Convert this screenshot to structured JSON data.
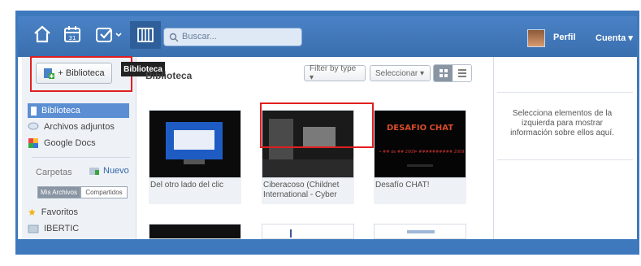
{
  "search": {
    "placeholder": "Buscar..."
  },
  "topbar": {
    "profile": "Perfil",
    "account": "Cuenta ▾"
  },
  "tooltip": "Biblioteca",
  "sidebar": {
    "add_library": "+ Biblioteca",
    "items": [
      {
        "label": "Biblioteca"
      },
      {
        "label": "Archivos adjuntos"
      },
      {
        "label": "Google Docs"
      }
    ],
    "folders_label": "Carpetas",
    "new_label": "Nuevo",
    "tabs": [
      "Mis Archivos",
      "Compartidos"
    ],
    "folders": [
      {
        "label": "Favoritos"
      },
      {
        "label": "IBERTIC"
      }
    ]
  },
  "main": {
    "title": "Biblioteca",
    "filter": "Filter by type ▾",
    "select": "Seleccionar ▾",
    "items": [
      {
        "caption": "Del otro lado del clic"
      },
      {
        "caption": "Ciberacoso (Childnet International - Cyber"
      },
      {
        "caption": "Desafío CHAT!"
      }
    ]
  },
  "thumb_text": {
    "desafio_title": "DESAFIO CHAT",
    "desafio_left": "• ## de ## 2009",
    "desafio_right": "• ########## 2009"
  },
  "right_pane": {
    "info": "Selecciona elementos de la izquierda para mostrar información sobre ellos aquí."
  },
  "colors": {
    "accent": "#3e79bd",
    "active_nav": "#5b8ed3",
    "highlight_box": "#e11f1f"
  }
}
